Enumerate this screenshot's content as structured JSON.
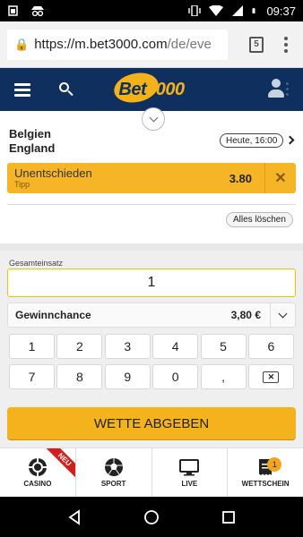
{
  "status_bar": {
    "time": "09:37"
  },
  "browser": {
    "url_host": "https://m.bet3000.com",
    "url_path": "/de/eve",
    "tab_count": "5"
  },
  "header": {
    "logo_text": "Bet",
    "logo_number": "3000"
  },
  "bet_slip": {
    "match": {
      "team1": "Belgien",
      "team2": "England",
      "time": "Heute, 16:00"
    },
    "selection": {
      "name": "Unentschieden",
      "type": "Tipp",
      "odds": "3.80",
      "remove_icon": "close-icon"
    },
    "clear_all_label": "Alles löschen"
  },
  "stake": {
    "label": "Gesamteinsatz",
    "value": "1",
    "win_label": "Gewinnchance",
    "win_value": "3,80 €"
  },
  "keypad": {
    "keys": [
      "1",
      "2",
      "3",
      "4",
      "5",
      "6",
      "7",
      "8",
      "9",
      "0",
      ","
    ]
  },
  "place_bet_label": "WETTE ABGEBEN",
  "bottom_nav": {
    "items": [
      {
        "label": "CASINO",
        "icon": "casino-chip-icon",
        "ribbon": "NEU"
      },
      {
        "label": "SPORT",
        "icon": "soccer-ball-icon"
      },
      {
        "label": "LIVE",
        "icon": "tv-icon"
      },
      {
        "label": "WETTSCHEIN",
        "icon": "bet-slip-icon",
        "badge": "1"
      }
    ]
  },
  "colors": {
    "brand_navy": "#0f2f5f",
    "accent_yellow": "#f5b526"
  }
}
